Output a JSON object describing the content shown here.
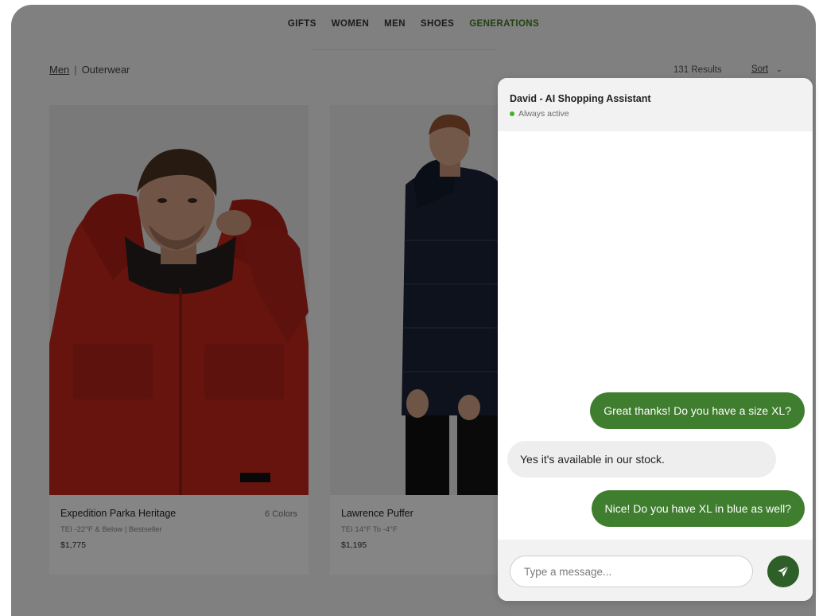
{
  "nav": {
    "items": [
      {
        "label": "GIFTS"
      },
      {
        "label": "WOMEN"
      },
      {
        "label": "MEN"
      },
      {
        "label": "SHOES"
      },
      {
        "label": "GENERATIONS"
      }
    ]
  },
  "breadcrumb": {
    "parent": "Men",
    "separator": "|",
    "current": "Outerwear"
  },
  "results": {
    "count_label": "131 Results"
  },
  "sort": {
    "label": "Sort",
    "chevron": "⌄"
  },
  "products": [
    {
      "name": "Expedition Parka Heritage",
      "colors": "6 Colors",
      "temp": "TEI -22°F & Below | Bestseller",
      "price": "$1,775"
    },
    {
      "name": "Lawrence Puffer",
      "colors": "",
      "temp": "TEI 14°F To -4°F",
      "price": "$1,195"
    }
  ],
  "chat": {
    "title": "David - AI Shopping Assistant",
    "status": "Always active",
    "messages": [
      {
        "sender": "user",
        "text": "Great thanks! Do you have a size XL?"
      },
      {
        "sender": "assistant",
        "text": "Yes it's available in our stock."
      },
      {
        "sender": "user",
        "text": "Nice! Do you have XL in blue as well?"
      }
    ],
    "input_placeholder": "Type a message...",
    "send_icon": "paper-plane-icon"
  },
  "colors": {
    "accent": "#3f7d2f",
    "send_button": "#2f5f28",
    "status_dot": "#43b02a"
  }
}
